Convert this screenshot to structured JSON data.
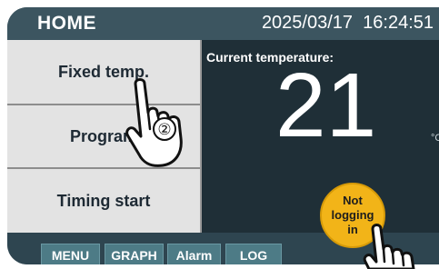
{
  "header": {
    "title": "HOME",
    "datetime": "2025/03/17  16:24:51"
  },
  "menu": {
    "items": [
      {
        "label": "Fixed temp."
      },
      {
        "label": "Program"
      },
      {
        "label": "Timing start"
      }
    ]
  },
  "temperature": {
    "label": "Current temperature:",
    "value": "21",
    "unit": "°C"
  },
  "bottom_nav": {
    "items": [
      {
        "label": "MENU"
      },
      {
        "label": "GRAPH"
      },
      {
        "label": "Alarm"
      },
      {
        "label": "LOG"
      }
    ]
  },
  "logging_badge": {
    "line1": "Not",
    "line2": "logging",
    "line3": "in"
  },
  "annotation": {
    "step_marker": "②"
  },
  "colors": {
    "screen_bg": "#1f2f37",
    "topbar_bg": "#3c5560",
    "menu_bg": "#e3e3e3",
    "nav_button_bg": "#4d7b86",
    "badge_bg": "#f2b418"
  },
  "icons": [
    "pointing-hand-icon",
    "pointing-hand-icon"
  ]
}
